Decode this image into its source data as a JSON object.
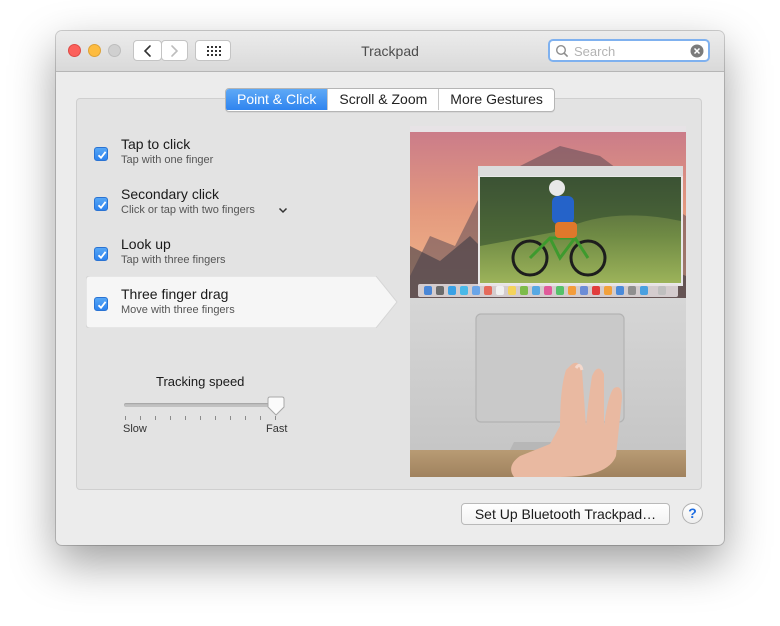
{
  "window": {
    "title": "Trackpad"
  },
  "search": {
    "placeholder": "Search"
  },
  "tabs": [
    {
      "label": "Point & Click",
      "active": true
    },
    {
      "label": "Scroll & Zoom",
      "active": false
    },
    {
      "label": "More Gestures",
      "active": false
    }
  ],
  "options": [
    {
      "label": "Tap to click",
      "sub": "Tap with one finger",
      "checked": true
    },
    {
      "label": "Secondary click",
      "sub": "Click or tap with two fingers",
      "checked": true
    },
    {
      "label": "Look up",
      "sub": "Tap with three fingers",
      "checked": true
    },
    {
      "label": "Three finger drag",
      "sub": "Move with three fingers",
      "checked": true
    }
  ],
  "tracking": {
    "title": "Tracking speed",
    "min_label": "Slow",
    "max_label": "Fast",
    "value": 1.0
  },
  "buttons": {
    "bluetooth": "Set Up Bluetooth Trackpad…",
    "help": "?"
  },
  "colors": {
    "accent": "#2f84ef",
    "window_bg": "#ececec"
  },
  "icons": [
    "back-icon",
    "forward-icon",
    "grid-icon",
    "search-icon",
    "clear-icon",
    "chevron-down-icon",
    "checkmark-icon"
  ]
}
